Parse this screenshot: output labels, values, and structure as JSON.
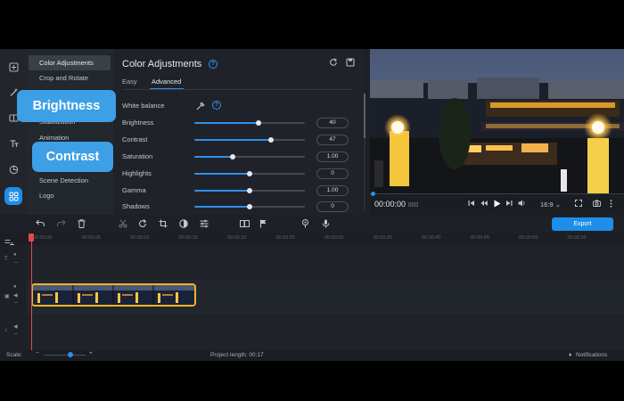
{
  "rail_icons": [
    "import-icon",
    "magic-wand-icon",
    "transitions-icon",
    "titles-icon",
    "stickers-icon",
    "more-tools-icon"
  ],
  "tools": [
    "Color Adjustments",
    "Crop and Rotate",
    "Stabilization",
    "Animation",
    "Scene Detection",
    "Logo"
  ],
  "panel": {
    "title": "Color Adjustments",
    "help": "?",
    "tabs": [
      "Easy",
      "Advanced"
    ],
    "white_balance_label": "White balance",
    "rows": [
      {
        "label": "Brightness",
        "value": "40",
        "fraction": 0.58
      },
      {
        "label": "Contrast",
        "value": "47",
        "fraction": 0.69
      },
      {
        "label": "Saturation",
        "value": "1.00",
        "fraction": 0.35
      },
      {
        "label": "Highlights",
        "value": "0",
        "fraction": 0.5
      },
      {
        "label": "Gamma",
        "value": "1.00",
        "fraction": 0.5
      },
      {
        "label": "Shadows",
        "value": "0",
        "fraction": 0.5
      }
    ]
  },
  "player": {
    "time": "00:00:00",
    "time_ms": "000",
    "aspect": "16:9"
  },
  "export_label": "Export",
  "ruler_labels": [
    "00:00:00",
    "00:00:05",
    "00:00:10",
    "00:00:15",
    "00:00:20",
    "00:00:25",
    "00:00:30",
    "00:00:35",
    "00:00:40",
    "00:00:45",
    "00:00:50",
    "00:00:55"
  ],
  "status": {
    "scale_label": "Scale:",
    "project_length": "Project length:  00:17",
    "notifications": "Notifications"
  },
  "callouts": {
    "brightness": "Brightness",
    "contrast": "Contrast"
  },
  "colors": {
    "accent": "#1e8ee8",
    "clip_border": "#f0b328",
    "playhead": "#e04a4a"
  }
}
